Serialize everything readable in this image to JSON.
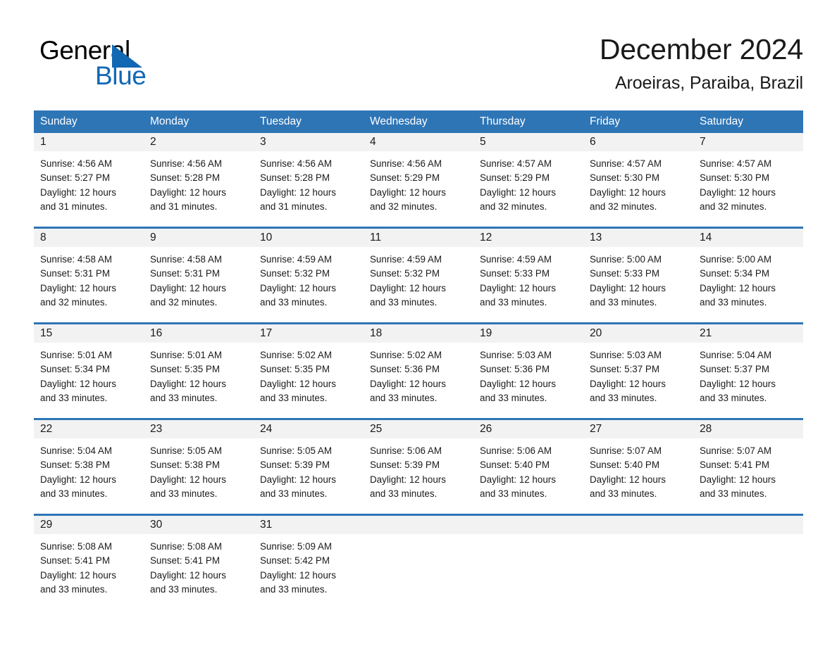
{
  "logo": {
    "word_general": "General",
    "word_blue": "Blue",
    "triangle_color": "#1268b3"
  },
  "header": {
    "title": "December 2024",
    "subtitle": "Aroeiras, Paraiba, Brazil"
  },
  "theme": {
    "header_bg": "#2e75b6",
    "daynum_bg": "#f2f2f2",
    "text": "#1a1a1a",
    "header_text": "#ffffff"
  },
  "weekdays": [
    "Sunday",
    "Monday",
    "Tuesday",
    "Wednesday",
    "Thursday",
    "Friday",
    "Saturday"
  ],
  "weeks": [
    {
      "days": [
        {
          "num": "1",
          "sunrise": "Sunrise: 4:56 AM",
          "sunset": "Sunset: 5:27 PM",
          "daylight1": "Daylight: 12 hours",
          "daylight2": "and 31 minutes."
        },
        {
          "num": "2",
          "sunrise": "Sunrise: 4:56 AM",
          "sunset": "Sunset: 5:28 PM",
          "daylight1": "Daylight: 12 hours",
          "daylight2": "and 31 minutes."
        },
        {
          "num": "3",
          "sunrise": "Sunrise: 4:56 AM",
          "sunset": "Sunset: 5:28 PM",
          "daylight1": "Daylight: 12 hours",
          "daylight2": "and 31 minutes."
        },
        {
          "num": "4",
          "sunrise": "Sunrise: 4:56 AM",
          "sunset": "Sunset: 5:29 PM",
          "daylight1": "Daylight: 12 hours",
          "daylight2": "and 32 minutes."
        },
        {
          "num": "5",
          "sunrise": "Sunrise: 4:57 AM",
          "sunset": "Sunset: 5:29 PM",
          "daylight1": "Daylight: 12 hours",
          "daylight2": "and 32 minutes."
        },
        {
          "num": "6",
          "sunrise": "Sunrise: 4:57 AM",
          "sunset": "Sunset: 5:30 PM",
          "daylight1": "Daylight: 12 hours",
          "daylight2": "and 32 minutes."
        },
        {
          "num": "7",
          "sunrise": "Sunrise: 4:57 AM",
          "sunset": "Sunset: 5:30 PM",
          "daylight1": "Daylight: 12 hours",
          "daylight2": "and 32 minutes."
        }
      ]
    },
    {
      "days": [
        {
          "num": "8",
          "sunrise": "Sunrise: 4:58 AM",
          "sunset": "Sunset: 5:31 PM",
          "daylight1": "Daylight: 12 hours",
          "daylight2": "and 32 minutes."
        },
        {
          "num": "9",
          "sunrise": "Sunrise: 4:58 AM",
          "sunset": "Sunset: 5:31 PM",
          "daylight1": "Daylight: 12 hours",
          "daylight2": "and 32 minutes."
        },
        {
          "num": "10",
          "sunrise": "Sunrise: 4:59 AM",
          "sunset": "Sunset: 5:32 PM",
          "daylight1": "Daylight: 12 hours",
          "daylight2": "and 33 minutes."
        },
        {
          "num": "11",
          "sunrise": "Sunrise: 4:59 AM",
          "sunset": "Sunset: 5:32 PM",
          "daylight1": "Daylight: 12 hours",
          "daylight2": "and 33 minutes."
        },
        {
          "num": "12",
          "sunrise": "Sunrise: 4:59 AM",
          "sunset": "Sunset: 5:33 PM",
          "daylight1": "Daylight: 12 hours",
          "daylight2": "and 33 minutes."
        },
        {
          "num": "13",
          "sunrise": "Sunrise: 5:00 AM",
          "sunset": "Sunset: 5:33 PM",
          "daylight1": "Daylight: 12 hours",
          "daylight2": "and 33 minutes."
        },
        {
          "num": "14",
          "sunrise": "Sunrise: 5:00 AM",
          "sunset": "Sunset: 5:34 PM",
          "daylight1": "Daylight: 12 hours",
          "daylight2": "and 33 minutes."
        }
      ]
    },
    {
      "days": [
        {
          "num": "15",
          "sunrise": "Sunrise: 5:01 AM",
          "sunset": "Sunset: 5:34 PM",
          "daylight1": "Daylight: 12 hours",
          "daylight2": "and 33 minutes."
        },
        {
          "num": "16",
          "sunrise": "Sunrise: 5:01 AM",
          "sunset": "Sunset: 5:35 PM",
          "daylight1": "Daylight: 12 hours",
          "daylight2": "and 33 minutes."
        },
        {
          "num": "17",
          "sunrise": "Sunrise: 5:02 AM",
          "sunset": "Sunset: 5:35 PM",
          "daylight1": "Daylight: 12 hours",
          "daylight2": "and 33 minutes."
        },
        {
          "num": "18",
          "sunrise": "Sunrise: 5:02 AM",
          "sunset": "Sunset: 5:36 PM",
          "daylight1": "Daylight: 12 hours",
          "daylight2": "and 33 minutes."
        },
        {
          "num": "19",
          "sunrise": "Sunrise: 5:03 AM",
          "sunset": "Sunset: 5:36 PM",
          "daylight1": "Daylight: 12 hours",
          "daylight2": "and 33 minutes."
        },
        {
          "num": "20",
          "sunrise": "Sunrise: 5:03 AM",
          "sunset": "Sunset: 5:37 PM",
          "daylight1": "Daylight: 12 hours",
          "daylight2": "and 33 minutes."
        },
        {
          "num": "21",
          "sunrise": "Sunrise: 5:04 AM",
          "sunset": "Sunset: 5:37 PM",
          "daylight1": "Daylight: 12 hours",
          "daylight2": "and 33 minutes."
        }
      ]
    },
    {
      "days": [
        {
          "num": "22",
          "sunrise": "Sunrise: 5:04 AM",
          "sunset": "Sunset: 5:38 PM",
          "daylight1": "Daylight: 12 hours",
          "daylight2": "and 33 minutes."
        },
        {
          "num": "23",
          "sunrise": "Sunrise: 5:05 AM",
          "sunset": "Sunset: 5:38 PM",
          "daylight1": "Daylight: 12 hours",
          "daylight2": "and 33 minutes."
        },
        {
          "num": "24",
          "sunrise": "Sunrise: 5:05 AM",
          "sunset": "Sunset: 5:39 PM",
          "daylight1": "Daylight: 12 hours",
          "daylight2": "and 33 minutes."
        },
        {
          "num": "25",
          "sunrise": "Sunrise: 5:06 AM",
          "sunset": "Sunset: 5:39 PM",
          "daylight1": "Daylight: 12 hours",
          "daylight2": "and 33 minutes."
        },
        {
          "num": "26",
          "sunrise": "Sunrise: 5:06 AM",
          "sunset": "Sunset: 5:40 PM",
          "daylight1": "Daylight: 12 hours",
          "daylight2": "and 33 minutes."
        },
        {
          "num": "27",
          "sunrise": "Sunrise: 5:07 AM",
          "sunset": "Sunset: 5:40 PM",
          "daylight1": "Daylight: 12 hours",
          "daylight2": "and 33 minutes."
        },
        {
          "num": "28",
          "sunrise": "Sunrise: 5:07 AM",
          "sunset": "Sunset: 5:41 PM",
          "daylight1": "Daylight: 12 hours",
          "daylight2": "and 33 minutes."
        }
      ]
    },
    {
      "days": [
        {
          "num": "29",
          "sunrise": "Sunrise: 5:08 AM",
          "sunset": "Sunset: 5:41 PM",
          "daylight1": "Daylight: 12 hours",
          "daylight2": "and 33 minutes."
        },
        {
          "num": "30",
          "sunrise": "Sunrise: 5:08 AM",
          "sunset": "Sunset: 5:41 PM",
          "daylight1": "Daylight: 12 hours",
          "daylight2": "and 33 minutes."
        },
        {
          "num": "31",
          "sunrise": "Sunrise: 5:09 AM",
          "sunset": "Sunset: 5:42 PM",
          "daylight1": "Daylight: 12 hours",
          "daylight2": "and 33 minutes."
        },
        {
          "num": "",
          "sunrise": "",
          "sunset": "",
          "daylight1": "",
          "daylight2": ""
        },
        {
          "num": "",
          "sunrise": "",
          "sunset": "",
          "daylight1": "",
          "daylight2": ""
        },
        {
          "num": "",
          "sunrise": "",
          "sunset": "",
          "daylight1": "",
          "daylight2": ""
        },
        {
          "num": "",
          "sunrise": "",
          "sunset": "",
          "daylight1": "",
          "daylight2": ""
        }
      ]
    }
  ]
}
